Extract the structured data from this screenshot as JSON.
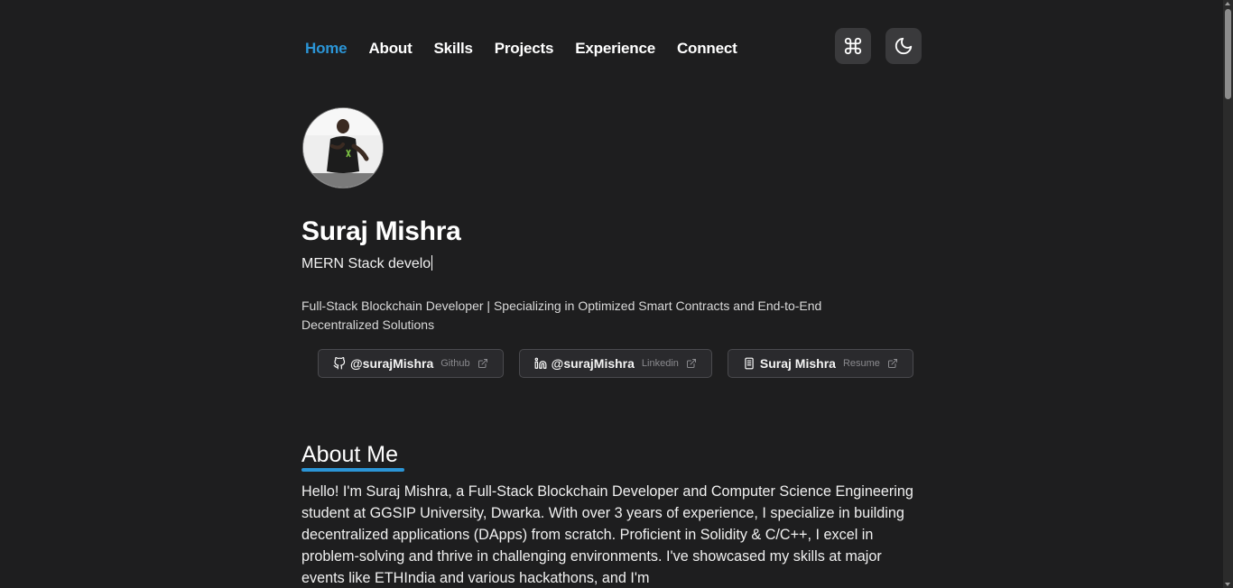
{
  "nav": {
    "items": [
      {
        "label": "Home",
        "active": true
      },
      {
        "label": "About",
        "active": false
      },
      {
        "label": "Skills",
        "active": false
      },
      {
        "label": "Projects",
        "active": false
      },
      {
        "label": "Experience",
        "active": false
      },
      {
        "label": "Connect",
        "active": false
      }
    ],
    "command_icon": "command-icon",
    "theme_icon": "moon-icon"
  },
  "profile": {
    "name": "Suraj Mishra",
    "typed_role": "MERN Stack develo",
    "tagline": "Full-Stack Blockchain Developer | Specializing in Optimized Smart Contracts and End-to-End Decentralized Solutions"
  },
  "links": [
    {
      "icon": "github-icon",
      "label": "@surajMishra",
      "sub": "Github"
    },
    {
      "icon": "linkedin-icon",
      "label": "@surajMishra",
      "sub": "Linkedin"
    },
    {
      "icon": "document-icon",
      "label": "Suraj Mishra",
      "sub": "Resume"
    }
  ],
  "about": {
    "title": "About Me",
    "body": "Hello! I'm Suraj Mishra, a Full-Stack Blockchain Developer and Computer Science Engineering student at GGSIP University, Dwarka. With over 3 years of experience, I specialize in building decentralized applications (DApps) from scratch. Proficient in Solidity & C/C++, I excel in problem-solving and thrive in challenging environments. I've showcased my skills at major events like ETHIndia and various hackathons, and I'm"
  },
  "colors": {
    "background": "#1e1e1f",
    "accent": "#2b95d6",
    "button_bg": "#2a2a2d"
  }
}
